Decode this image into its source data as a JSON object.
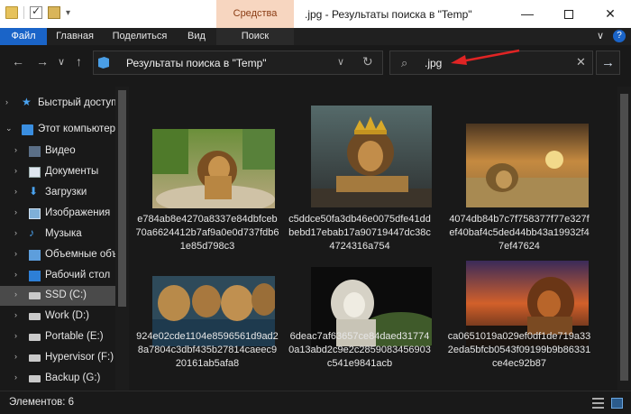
{
  "window": {
    "title": ".jpg - Результаты поиска в \"Temp\"",
    "context_tab": "Средства поиска",
    "minimize": "—",
    "close": "✕"
  },
  "ribbon": {
    "tabs": [
      "Файл",
      "Главная",
      "Поделиться",
      "Вид",
      "Поиск"
    ],
    "expand": "∨",
    "help": "?"
  },
  "address": {
    "path": "Результаты поиска в \"Temp\"",
    "back": "←",
    "forward": "→",
    "recent": "∨",
    "up": "↑",
    "dropdown": "∨",
    "refresh": "↻"
  },
  "search": {
    "value": ".jpg",
    "icon": "⌕",
    "clear": "✕",
    "go": "→"
  },
  "sidebar": {
    "items": [
      {
        "label": "Быстрый доступ",
        "icon": "star-icon",
        "chev": "›"
      },
      {
        "label": "Этот компьютер",
        "icon": "pc-icon",
        "chev": "⌄"
      },
      {
        "label": "Видео",
        "icon": "video-icon",
        "chev": "›"
      },
      {
        "label": "Документы",
        "icon": "documents-icon",
        "chev": "›"
      },
      {
        "label": "Загрузки",
        "icon": "downloads-icon",
        "chev": "›"
      },
      {
        "label": "Изображения",
        "icon": "pictures-icon",
        "chev": "›"
      },
      {
        "label": "Музыка",
        "icon": "music-icon",
        "chev": "›"
      },
      {
        "label": "Объемные объ",
        "icon": "3d-objects-icon",
        "chev": "›"
      },
      {
        "label": "Рабочий стол",
        "icon": "desktop-icon",
        "chev": "›"
      },
      {
        "label": "SSD (C:)",
        "icon": "drive-icon",
        "chev": "›",
        "selected": true
      },
      {
        "label": "Work (D:)",
        "icon": "drive-icon",
        "chev": "›"
      },
      {
        "label": "Portable (E:)",
        "icon": "drive-icon",
        "chev": "›"
      },
      {
        "label": "Hypervisor (F:)",
        "icon": "drive-icon",
        "chev": "›"
      },
      {
        "label": "Backup (G:)",
        "icon": "drive-icon",
        "chev": "›"
      }
    ]
  },
  "files": [
    {
      "name": "e784ab8e4270a8337e84dbfceb70a6624412b7af9a0e0d737fdb61e85d798c3",
      "image": "lion on rocks"
    },
    {
      "name": "c5ddce50fa3db46e0075dfe41ddbebd17ebab17a90719447dc38c4724316a754",
      "image": "lion with crown"
    },
    {
      "name": "4074db84b7c7f758377f77e327fef40baf4c5ded44bb43a19932f47ef47624",
      "image": "lion in savanna at sunset"
    },
    {
      "name": "924e02cde1104e8596561d9ad28a7804c3dbf435b27814caeec920161ab5afa8",
      "image": "lions drinking water"
    },
    {
      "name": "6deac7af63657ce84daed317740a13abd2c9e2c2859083456903c541e9841acb",
      "image": "white lion on rock"
    },
    {
      "name": "ca0651019a029ef0df1de719a332eda5bfcb0543f09199b9b86331ce4ec92b87",
      "image": "roaring lion at sunset"
    }
  ],
  "status": {
    "count": "Элементов: 6"
  },
  "colors": {
    "accent": "#1a64c8",
    "arrow": "#e02424",
    "background": "#191919"
  }
}
